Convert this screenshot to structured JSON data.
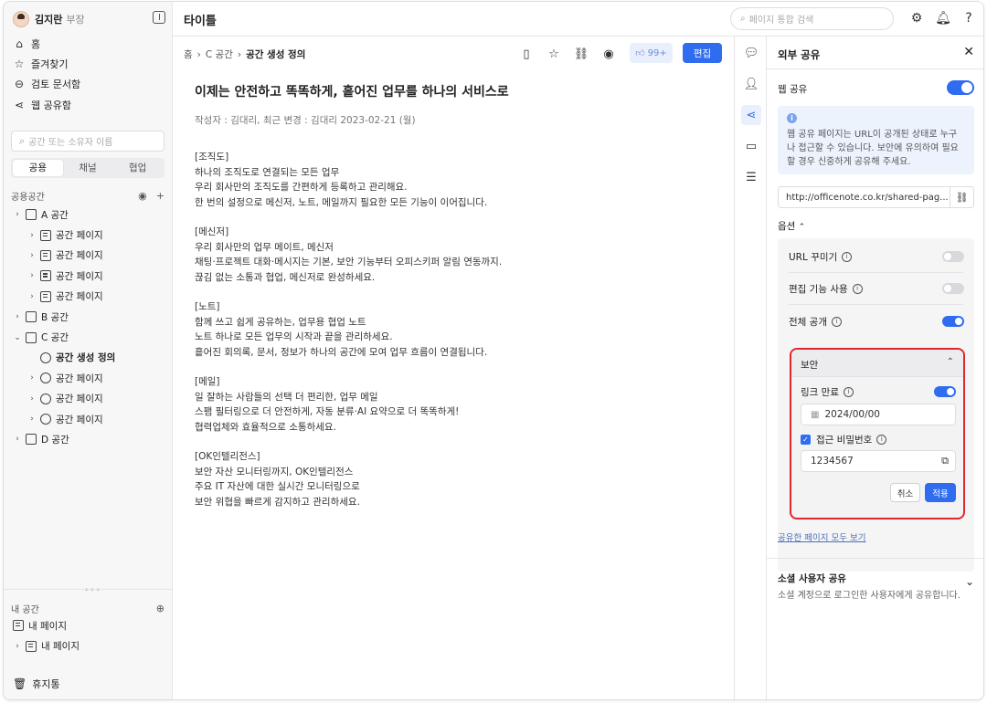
{
  "sidebar": {
    "user": {
      "name": "김지란",
      "role": "부장"
    },
    "nav": [
      {
        "label": "홈",
        "icon": "home-icon"
      },
      {
        "label": "즐겨찾기",
        "icon": "star-icon"
      },
      {
        "label": "검토 문서함",
        "icon": "inbox-icon"
      },
      {
        "label": "웹 공유함",
        "icon": "share-icon"
      }
    ],
    "search_placeholder": "공간 또는 소유자 이름",
    "tabs": [
      "공용",
      "채널",
      "협업"
    ],
    "public_section": "공용공간",
    "tree": [
      {
        "label": "A 공간",
        "indent": 0,
        "caret": "›",
        "icon": "cube"
      },
      {
        "label": "공간 페이지",
        "indent": 1,
        "caret": "›",
        "icon": "page"
      },
      {
        "label": "공간 페이지",
        "indent": 1,
        "caret": "›",
        "icon": "page"
      },
      {
        "label": "공간 페이지",
        "indent": 1,
        "caret": "›",
        "icon": "page"
      },
      {
        "label": "공간 페이지",
        "indent": 1,
        "caret": "›",
        "icon": "page"
      },
      {
        "label": "B 공간",
        "indent": 0,
        "caret": "›",
        "icon": "cube"
      },
      {
        "label": "C 공간",
        "indent": 0,
        "caret": "⌄",
        "icon": "cube"
      },
      {
        "label": "공간 생성 정의",
        "indent": 1,
        "caret": "",
        "icon": "share",
        "selected": true
      },
      {
        "label": "공간 페이지",
        "indent": 1,
        "caret": "›",
        "icon": "share"
      },
      {
        "label": "공간 페이지",
        "indent": 1,
        "caret": "›",
        "icon": "share"
      },
      {
        "label": "공간 페이지",
        "indent": 1,
        "caret": "›",
        "icon": "share"
      },
      {
        "label": "D 공간",
        "indent": 0,
        "caret": "›",
        "icon": "cube"
      }
    ],
    "my_section": "내 공간",
    "my_tree": [
      {
        "label": "내 페이지",
        "caret": ""
      },
      {
        "label": "내 페이지",
        "caret": "›"
      }
    ],
    "trash": "휴지통"
  },
  "topbar": {
    "title": "타이틀",
    "search_placeholder": "페이지 통합 검색"
  },
  "doc": {
    "breadcrumb": [
      "홈",
      "C 공간",
      "공간 생성 정의"
    ],
    "likes": "99+",
    "edit": "편집",
    "heading": "이제는 안전하고 똑똑하게, 흩어진 업무를 하나의 서비스로",
    "meta": "작성자 : 김대리,  최근 변경 : 김대리  2023-02-21 (월)",
    "paragraphs": [
      [
        "[조직도]",
        "하나의 조직도로 연결되는 모든 업무",
        "우리 회사만의 조직도를 간편하게 등록하고 관리해요.",
        "한 번의 설정으로 메신저, 노트, 메일까지 필요한 모든 기능이 이어집니다.",
        " ",
        " "
      ],
      [
        "[메신저]",
        "우리 회사만의 업무 메이트, 메신저",
        "채팅·프로젝트 대화·메시지는 기본, 보안 기능부터 오피스키퍼 알림 연동까지.",
        "끊김 없는 소통과 협업, 메신저로 완성하세요."
      ],
      [
        "[노트]",
        "함께 쓰고 쉽게 공유하는, 업무용 협업 노트",
        "노트 하나로 모든 업무의 시작과 끝을 관리하세요.",
        "흩어진 회의록, 문서, 정보가 하나의 공간에 모여 업무 흐름이 연결됩니다."
      ],
      [
        "[메일]",
        "일 잘하는 사람들의 선택 더 편리한, 업무 메일",
        "스팸 필터링으로 더 안전하게, 자동 분류·AI 요약으로 더 똑똑하게!",
        "협력업체와 효율적으로 소통하세요."
      ],
      [
        "[OK인텔리전스]",
        "보안 자산 모니터링까지, OK인텔리전스",
        "주요 IT 자산에 대한 실시간 모니터링으로",
        "보안 위협을 빠르게 감지하고 관리하세요."
      ]
    ]
  },
  "panel": {
    "title": "외부 공유",
    "web_share": "웹 공유",
    "info": "웹 공유 페이지는 URL이 공개된 상태로 누구나 접근할 수 있습니다. 보안에 유의하여 필요할 경우 신중하게 공유해 주세요.",
    "url": "http://officenote.co.kr/shared-pag...",
    "options_label": "옵션",
    "options": [
      {
        "label": "URL 꾸미기",
        "on": false
      },
      {
        "label": "편집 기능 사용",
        "on": false
      },
      {
        "label": "전체 공개",
        "on": true
      }
    ],
    "security": {
      "title": "보안",
      "link_expiry": "링크 만료",
      "date": "2024/00/00",
      "password_label": "접근 비밀번호",
      "password": "1234567",
      "cancel": "취소",
      "apply": "적용"
    },
    "view_all": "공유한 페이지 모두 보기",
    "social_title": "소셜 사용자 공유",
    "social_desc": "소셜 계정으로 로그인한 사용자에게 공유합니다."
  }
}
